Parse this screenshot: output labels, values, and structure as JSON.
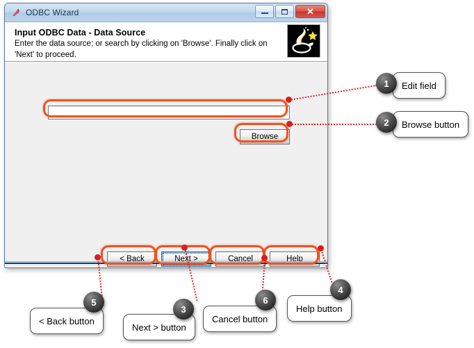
{
  "window": {
    "title": "ODBC Wizard",
    "title_icon": "odbc-wizard-arrow-icon",
    "controls": {
      "minimize": "minimize-icon",
      "maximize": "maximize-icon",
      "close": "✕"
    },
    "header": {
      "title": "Input ODBC Data - Data Source",
      "subtitle": "Enter the data source; or search by clicking on 'Browse'.  Finally click on 'Next' to proceed.",
      "logo": "genie-lamp-logo-icon"
    },
    "edit_field": {
      "value": "",
      "placeholder": ""
    },
    "browse_label": "Browse",
    "buttons": [
      {
        "label": "< Back",
        "focused": false
      },
      {
        "label": "Next >",
        "focused": true
      },
      {
        "label": "Cancel",
        "focused": false
      },
      {
        "label": "Help",
        "focused": false
      }
    ]
  },
  "annotations": {
    "highlight_color": "#f4511e",
    "connector_color": "#e02020",
    "items": [
      {
        "number": "1",
        "label": "Edit field"
      },
      {
        "number": "2",
        "label": "Browse button"
      },
      {
        "number": "3",
        "label": "Next > button"
      },
      {
        "number": "4",
        "label": "Help button"
      },
      {
        "number": "5",
        "label": "< Back button"
      },
      {
        "number": "6",
        "label": "Cancel button"
      }
    ]
  }
}
